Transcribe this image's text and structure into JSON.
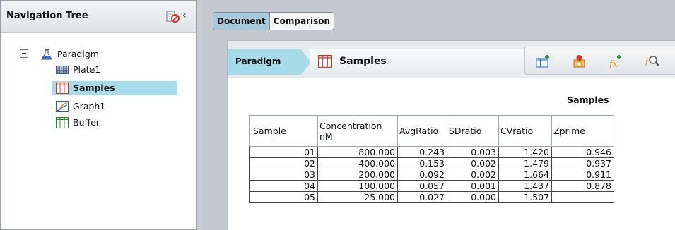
{
  "nav": {
    "title": "Navigation Tree",
    "collapse_glyph": "‹",
    "tree": {
      "root": "Paradigm",
      "children": [
        "Plate1",
        "Samples",
        "Graph1",
        "Buffer"
      ],
      "selected": "Samples"
    }
  },
  "tabs": [
    "Document",
    "Comparison"
  ],
  "active_tab": "Document",
  "breadcrumb": {
    "root": "Paradigm",
    "current": "Samples"
  },
  "toolbar_icons": [
    "insert-table-icon",
    "insert-sample-icon",
    "insert-function-icon",
    "function-search-icon"
  ],
  "sheet": {
    "title": "Samples",
    "columns": [
      "Sample",
      "Concentration nM",
      "AvgRatio",
      "SDratio",
      "CVratio",
      "Zprime"
    ],
    "rows": [
      [
        "01",
        "800.000",
        "0.243",
        "0.003",
        "1.420",
        "0.946"
      ],
      [
        "02",
        "400.000",
        "0.153",
        "0.002",
        "1.479",
        "0.937"
      ],
      [
        "03",
        "200.000",
        "0.092",
        "0.002",
        "1.664",
        "0.911"
      ],
      [
        "04",
        "100.000",
        "0.057",
        "0.001",
        "1.437",
        "0.878"
      ],
      [
        "05",
        "25.000",
        "0.027",
        "0.000",
        "1.507",
        ""
      ]
    ]
  },
  "colors": {
    "selection": "#a8dbe9",
    "active_tab": "#a7c9db",
    "accent_orange": "#e8922b",
    "accent_red": "#d9302a"
  }
}
